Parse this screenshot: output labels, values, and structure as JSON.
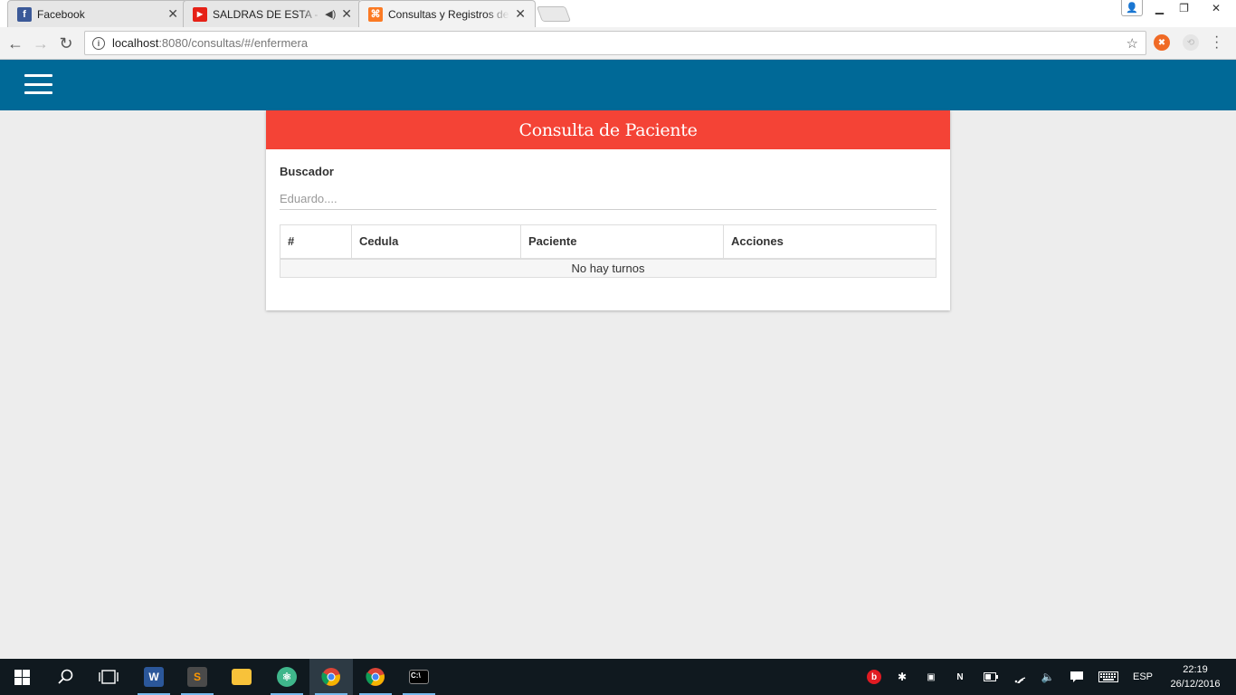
{
  "browser": {
    "tabs": [
      {
        "title": "Facebook",
        "favicon": "facebook-icon",
        "favicon_color": "#3b5998",
        "active": false,
        "audio": false
      },
      {
        "title": "SALDRAS DE ESTA - R",
        "favicon": "youtube-icon",
        "favicon_color": "#e62117",
        "active": false,
        "audio": true
      },
      {
        "title": "Consultas y Registros de",
        "favicon": "xampp-icon",
        "favicon_color": "#fb7a24",
        "active": true,
        "audio": false
      }
    ],
    "address": {
      "host": "localhost",
      "path": ":8080/consultas/#/enfermera"
    },
    "toolbar_icons": [
      "back-icon",
      "forward-icon",
      "reload-icon",
      "info-icon",
      "star-icon",
      "extension-icon",
      "menu-icon"
    ]
  },
  "app": {
    "header_color": "#006997",
    "menu_icon": "hamburger-icon"
  },
  "card": {
    "title": "Consulta de Paciente",
    "accent_color": "#f44336",
    "search": {
      "label": "Buscador",
      "placeholder": "Eduardo....",
      "value": ""
    },
    "table": {
      "columns": [
        "#",
        "Cedula",
        "Paciente",
        "Acciones"
      ],
      "empty_message": "No hay turnos"
    }
  },
  "taskbar": {
    "apps": [
      "windows-start-icon",
      "search-icon",
      "task-view-icon",
      "word-icon",
      "sublime-icon",
      "file-explorer-icon",
      "atom-icon",
      "chrome-icon",
      "chrome-icon",
      "terminal-icon"
    ],
    "tray_icons": [
      "beats-icon",
      "bluetooth-icon",
      "network-drive-icon",
      "onenote-icon",
      "battery-icon",
      "wifi-icon",
      "volume-icon",
      "notification-icon",
      "keyboard-icon"
    ],
    "language": "ESP",
    "time": "22:19",
    "date": "26/12/2016"
  }
}
